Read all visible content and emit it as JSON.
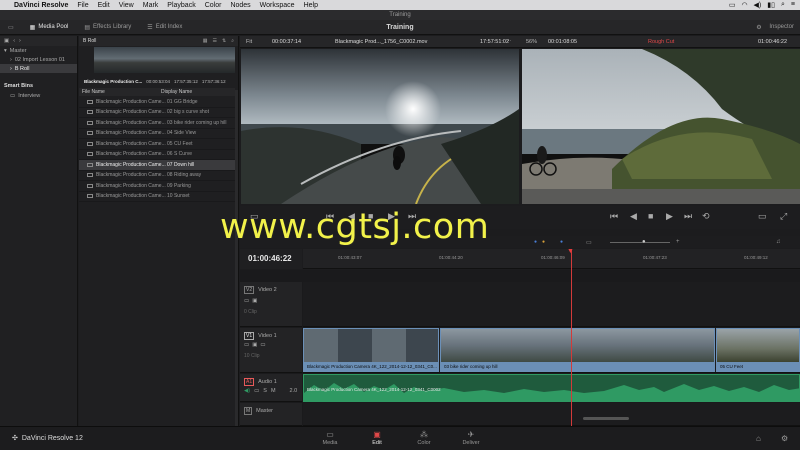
{
  "menubar": {
    "app": "DaVinci Resolve",
    "items": [
      "File",
      "Edit",
      "View",
      "Mark",
      "Playback",
      "Color",
      "Nodes",
      "Workspace",
      "Help"
    ]
  },
  "window_title": "Training",
  "toolbar": {
    "media_pool": "Media Pool",
    "effects_library": "Effects Library",
    "edit_index": "Edit Index",
    "project_name": "Training",
    "inspector": "Inspector"
  },
  "bins": {
    "header": "B Roll",
    "items": [
      "Master",
      "02 Import Lesson 01",
      "B Roll"
    ],
    "smart_bins_title": "Smart Bins",
    "smart_bins": [
      "Interview"
    ]
  },
  "clip_preview": {
    "name": "Blackmagic Production C...",
    "tc_in": "00:00:53:04",
    "tc_out": "17:57:35:12",
    "tc_dur": "17:57:36:12"
  },
  "clip_list": {
    "col_file": "File Name",
    "col_display": "Display Name",
    "rows": [
      {
        "file": "Blackmagic Production Came...",
        "display": "01 GG Bridge"
      },
      {
        "file": "Blackmagic Production Came...",
        "display": "02 big s curve shot"
      },
      {
        "file": "Blackmagic Production Came...",
        "display": "03 bike rider coming up hill"
      },
      {
        "file": "Blackmagic Production Came...",
        "display": "04 Side View"
      },
      {
        "file": "Blackmagic Production Came...",
        "display": "05 CU Feet"
      },
      {
        "file": "Blackmagic Production Came...",
        "display": "06 S Curve"
      },
      {
        "file": "Blackmagic Production Came...",
        "display": "07 Down hill"
      },
      {
        "file": "Blackmagic Production Came...",
        "display": "08 Riding away"
      },
      {
        "file": "Blackmagic Production Came...",
        "display": "09 Parking"
      },
      {
        "file": "Blackmagic Production Came...",
        "display": "10 Sunset"
      }
    ],
    "selected_index": 6
  },
  "source_viewer": {
    "fit": "Fit",
    "timecode_left": "00:00:37:14",
    "clip_name": "Blackmagic Prod..._1756_C0002.mov",
    "timecode_right": "17:57:51:02"
  },
  "record_viewer": {
    "zoom": "56%",
    "timecode_left": "00:01:08:05",
    "timeline_name": "Rough Cut",
    "timecode_right": "01:00:46:22"
  },
  "watermark": "www.cgtsj.com",
  "timeline": {
    "current_tc": "01:00:46:22",
    "ruler_ticks": [
      "01:00:43:07",
      "01:00:44:20",
      "01:00:46:09",
      "01:00:47:23",
      "01:00:49:12"
    ],
    "tracks": {
      "v2": {
        "tag": "V2",
        "name": "Video 2",
        "sub": "0 Clip"
      },
      "v1": {
        "tag": "V1",
        "name": "Video 1",
        "sub": "10 Clip"
      },
      "a1": {
        "tag": "A1",
        "name": "Audio 1",
        "level": "2.0"
      },
      "m": {
        "tag": "M",
        "name": "Master"
      }
    },
    "video_clips": [
      {
        "label": "Blackmagic Production Camera 4K_122_2014-12-12_0341_C0..."
      },
      {
        "label": "03 bike rider coming up hill"
      },
      {
        "label": "05 CU Feet"
      }
    ],
    "audio_clip": {
      "label": "Blackmagic Production Camera 4K_122_2014-12-12_0341_C0002"
    }
  },
  "pages": {
    "brand": "DaVinci Resolve 12",
    "media": "Media",
    "edit": "Edit",
    "color": "Color",
    "deliver": "Deliver"
  },
  "colors": {
    "accent_red": "#e04848",
    "clip_blue": "#6b8fb6",
    "audio_green": "#2f9a63",
    "watermark_yellow": "#f2f24a"
  }
}
